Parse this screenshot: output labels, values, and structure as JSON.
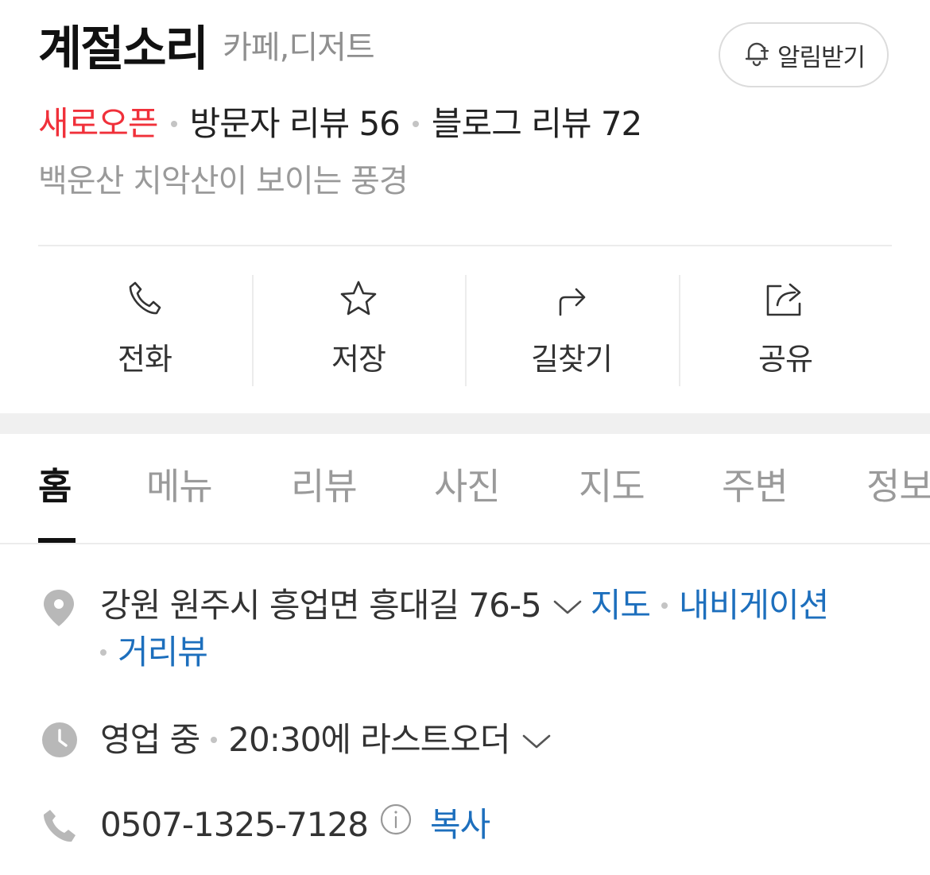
{
  "header": {
    "title": "계절소리",
    "category": "카페,디저트",
    "alarm_label": "알림받기"
  },
  "stats": {
    "badge": "새로오픈",
    "visitor_reviews": "방문자 리뷰 56",
    "blog_reviews": "블로그 리뷰 72"
  },
  "description": "백운산 치악산이 보이는 풍경",
  "actions": [
    {
      "label": "전화",
      "icon": "phone-icon"
    },
    {
      "label": "저장",
      "icon": "star-icon"
    },
    {
      "label": "길찾기",
      "icon": "directions-icon"
    },
    {
      "label": "공유",
      "icon": "share-icon"
    }
  ],
  "tabs": [
    {
      "label": "홈",
      "active": true
    },
    {
      "label": "메뉴"
    },
    {
      "label": "리뷰"
    },
    {
      "label": "사진"
    },
    {
      "label": "지도"
    },
    {
      "label": "주변"
    },
    {
      "label": "정보"
    }
  ],
  "address": {
    "text": "강원 원주시 흥업면 흥대길 76-5",
    "links": [
      "지도",
      "내비게이션",
      "거리뷰"
    ]
  },
  "hours": {
    "status": "영업 중",
    "last_order": "20:30에 라스트오더"
  },
  "phone": {
    "number": "0507-1325-7128",
    "copy_label": "복사"
  },
  "colors": {
    "accent_red": "#f0303a",
    "link_blue": "#1d6fbd",
    "muted_text": "#9a9a9a"
  }
}
